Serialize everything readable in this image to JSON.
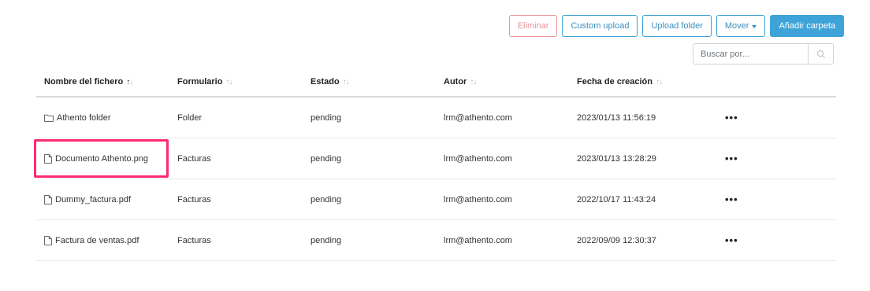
{
  "toolbar": {
    "delete_label": "Eliminar",
    "custom_upload_label": "Custom upload",
    "upload_folder_label": "Upload folder",
    "move_label": "Mover",
    "add_folder_label": "Añadir carpeta"
  },
  "search": {
    "placeholder": "Buscar por..."
  },
  "table": {
    "headers": {
      "name": "Nombre del fichero",
      "form": "Formulario",
      "state": "Estado",
      "author": "Autor",
      "created": "Fecha de creación"
    },
    "rows": [
      {
        "icon": "folder-icon",
        "name": "Athento folder",
        "form": "Folder",
        "state": "pending",
        "author": "lrm@athento.com",
        "created": "2023/01/13 11:56:19",
        "actions": "•••"
      },
      {
        "icon": "file-icon",
        "name": "Documento Athento.png",
        "form": "Facturas",
        "state": "pending",
        "author": "lrm@athento.com",
        "created": "2023/01/13 13:28:29",
        "actions": "•••"
      },
      {
        "icon": "file-icon",
        "name": "Dummy_factura.pdf",
        "form": "Facturas",
        "state": "pending",
        "author": "lrm@athento.com",
        "created": "2022/10/17 11:43:24",
        "actions": "•••"
      },
      {
        "icon": "file-icon",
        "name": "Factura de ventas.pdf",
        "form": "Facturas",
        "state": "pending",
        "author": "lrm@athento.com",
        "created": "2022/09/09 12:30:37",
        "actions": "•••"
      }
    ]
  },
  "colors": {
    "accent": "#3ea3d8",
    "danger": "#e8959a",
    "highlight": "#ff2a6d"
  }
}
